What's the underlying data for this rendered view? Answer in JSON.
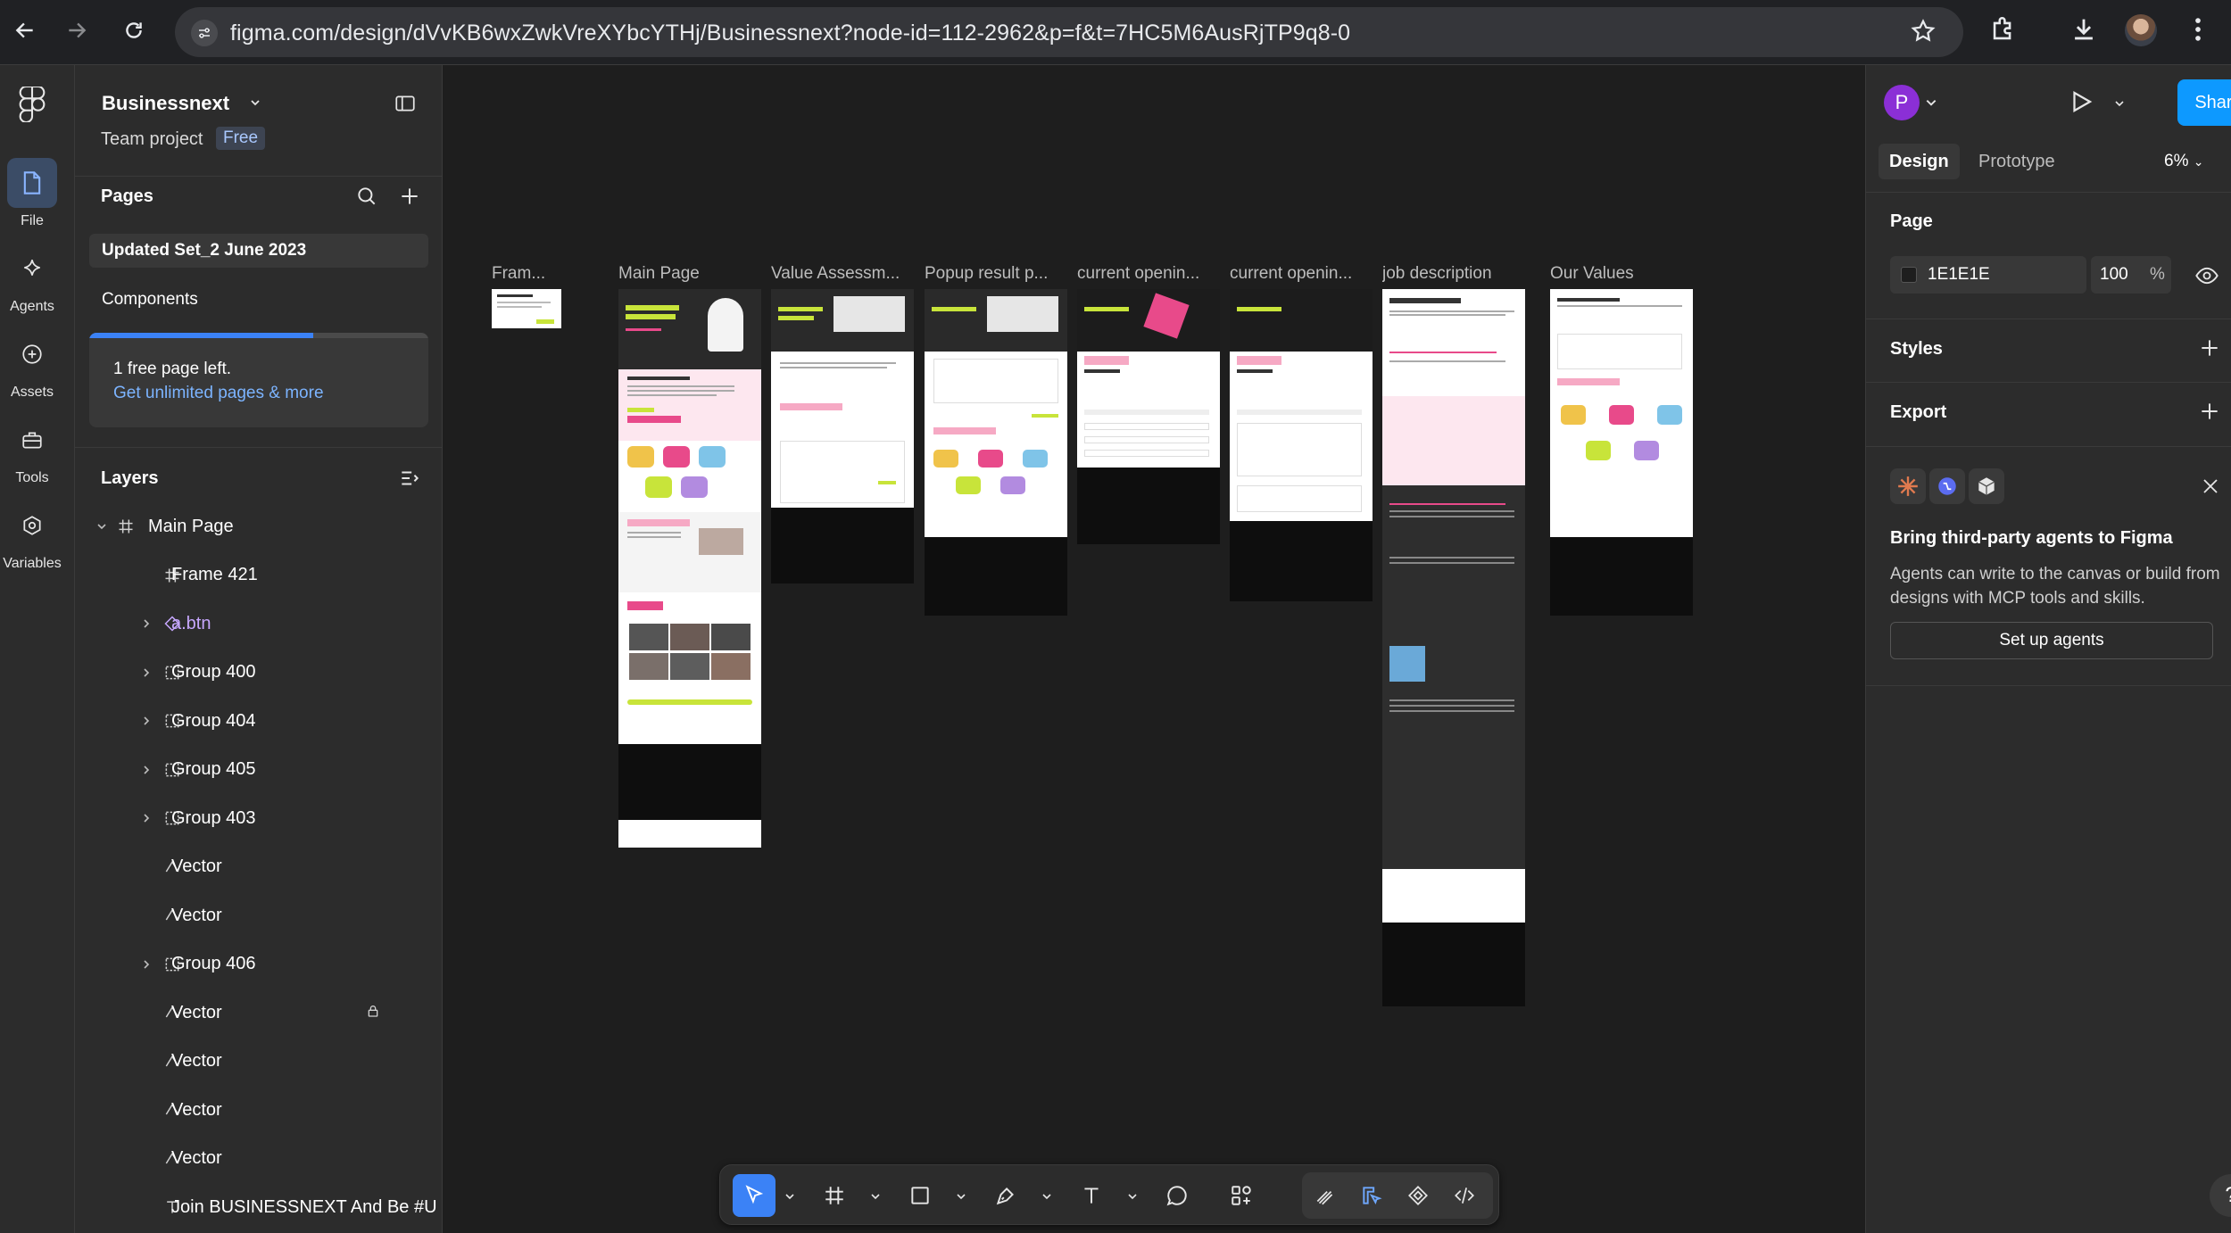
{
  "browser": {
    "url": "figma.com/design/dVvKB6wxZwkVreXYbcYTHj/Businessnext?node-id=112-2962&p=f&t=7HC5M6AusRjTP9q8-0"
  },
  "rail": {
    "items": [
      {
        "label": "File",
        "icon": "file-icon"
      },
      {
        "label": "Agents",
        "icon": "sparkle-icon"
      },
      {
        "label": "Assets",
        "icon": "plus-circle-icon"
      },
      {
        "label": "Tools",
        "icon": "toolbox-icon"
      },
      {
        "label": "Variables",
        "icon": "variables-icon"
      }
    ]
  },
  "project": {
    "name": "Businessnext",
    "team": "Team project",
    "plan": "Free"
  },
  "pages": {
    "title": "Pages",
    "items": [
      "Updated Set_2 June 2023",
      "Components"
    ],
    "upsell_line1": "1 free page left.",
    "upsell_line2": "Get unlimited pages & more",
    "upsell_progress": 0.66
  },
  "layers": {
    "title": "Layers",
    "items": [
      {
        "name": "Main Page",
        "icon": "frame-icon",
        "level": 0,
        "expandable": true,
        "expanded": true
      },
      {
        "name": "Frame 421",
        "icon": "frame-icon",
        "level": 1,
        "expandable": false
      },
      {
        "name": "a.btn",
        "icon": "component-instance-icon",
        "level": 1,
        "expandable": true
      },
      {
        "name": "Group 400",
        "icon": "group-icon",
        "level": 1,
        "expandable": true
      },
      {
        "name": "Group 404",
        "icon": "group-icon",
        "level": 1,
        "expandable": true
      },
      {
        "name": "Group 405",
        "icon": "group-icon",
        "level": 1,
        "expandable": true
      },
      {
        "name": "Group 403",
        "icon": "group-icon",
        "level": 1,
        "expandable": true
      },
      {
        "name": "Vector",
        "icon": "vector-icon",
        "level": 1,
        "expandable": false
      },
      {
        "name": "Vector",
        "icon": "vector-icon",
        "level": 1,
        "expandable": false
      },
      {
        "name": "Group 406",
        "icon": "group-icon",
        "level": 1,
        "expandable": true
      },
      {
        "name": "Vector",
        "icon": "vector-icon",
        "level": 1,
        "expandable": false,
        "locked": true
      },
      {
        "name": "Vector",
        "icon": "vector-icon",
        "level": 1,
        "expandable": false
      },
      {
        "name": "Vector",
        "icon": "vector-icon",
        "level": 1,
        "expandable": false
      },
      {
        "name": "Vector",
        "icon": "vector-icon",
        "level": 1,
        "expandable": false
      },
      {
        "name": "Join BUSINESSNEXT And Be #U",
        "icon": "text-icon",
        "level": 1,
        "expandable": false
      }
    ]
  },
  "canvas": {
    "frames": [
      {
        "label": "Fram..."
      },
      {
        "label": "Main Page"
      },
      {
        "label": "Value Assessm..."
      },
      {
        "label": "Popup result p..."
      },
      {
        "label": "current openin..."
      },
      {
        "label": "current openin..."
      },
      {
        "label": "job description"
      },
      {
        "label": "Our Values"
      }
    ]
  },
  "right_panel": {
    "avatar_initial": "P",
    "share_label": "Share",
    "tab_design": "Design",
    "tab_prototype": "Prototype",
    "zoom": "6%",
    "page_title": "Page",
    "page_color_hex": "1E1E1E",
    "page_opacity": "100",
    "page_opacity_unit": "%",
    "styles_title": "Styles",
    "export_title": "Export",
    "agents_title": "Bring third-party agents to Figma",
    "agents_body": "Agents can write to the canvas or build from designs with MCP tools and skills.",
    "agents_button": "Set up agents",
    "help": "?"
  },
  "colors": {
    "canvas_bg": "#1e1e1e",
    "panel_bg": "#2c2c2c",
    "accent": "#0d99ff",
    "selection": "#3b82f6",
    "brand_lime": "#c8e43a",
    "brand_pink": "#e84a8a"
  }
}
